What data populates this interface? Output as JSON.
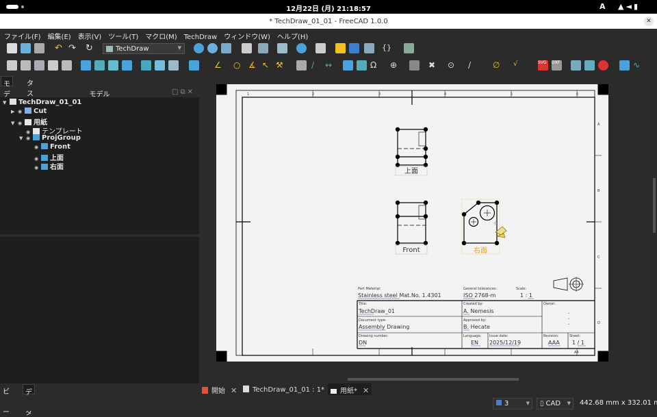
{
  "system": {
    "datetime": "12月22日 (月)  21:18:57",
    "input_indicator": "A"
  },
  "window": {
    "title": "* TechDraw_01_01 - FreeCAD 1.0.0",
    "close_glyph": "✕"
  },
  "menu": [
    "ファイル(F)",
    "編集(E)",
    "表示(V)",
    "ツール(T)",
    "マクロ(M)",
    "TechDraw",
    "ウィンドウ(W)",
    "ヘルプ(H)"
  ],
  "toolbar": {
    "workbench": "TechDraw"
  },
  "left_panel": {
    "tabs": [
      "モデル",
      "タスク"
    ],
    "header": "モデル",
    "tree": [
      {
        "label": "TechDraw_01_01",
        "level": 0,
        "expanded": true,
        "bold": true,
        "icon_color": "#e0e0e0"
      },
      {
        "label": "Cut",
        "level": 1,
        "expanded": false,
        "bold": true,
        "icon_color": "#7ab3e8"
      },
      {
        "label": "用紙",
        "level": 1,
        "expanded": true,
        "bold": true,
        "icon_color": "#e8e8e8"
      },
      {
        "label": "テンプレート",
        "level": 2,
        "expanded": null,
        "bold": false,
        "icon_color": "#e8e8e8"
      },
      {
        "label": "ProjGroup",
        "level": 2,
        "expanded": true,
        "bold": true,
        "icon_color": "#4aa3d8"
      },
      {
        "label": "Front",
        "level": 3,
        "expanded": null,
        "bold": true,
        "icon_color": "#4aa3d8"
      },
      {
        "label": "上面",
        "level": 3,
        "expanded": null,
        "bold": true,
        "icon_color": "#4aa3d8"
      },
      {
        "label": "右面",
        "level": 3,
        "expanded": null,
        "bold": true,
        "icon_color": "#4aa3d8"
      }
    ],
    "bottom_tabs": [
      "ビュー",
      "データ"
    ]
  },
  "drawing": {
    "columns": [
      "1",
      "2",
      "3",
      "4",
      "5",
      "6"
    ],
    "rows": [
      "A",
      "B",
      "C",
      "D"
    ],
    "view_labels": {
      "top": "上面",
      "front": "Front",
      "right": "右面"
    },
    "sheet_size": "A4",
    "title_block": {
      "part_material_label": "Part Material:",
      "part_material": "Stainless steel Mat.No. 1.4301",
      "tolerances_label": "General tolerances:",
      "tolerances": "ISO 2768-m",
      "scale_label": "Scale:",
      "scale": "1 : 1",
      "title_label": "Title:",
      "title": "TechDraw_01",
      "created_label": "Created by:",
      "created": "A. Nemesis",
      "owner_label": "Owner:",
      "owner_lines": [
        "-",
        "-",
        "-"
      ],
      "doctype_label": "Document type:",
      "doctype": "Assembly Drawing",
      "approved_label": "Approved by:",
      "approved": "B. Hecate",
      "drawing_number_label": "Drawing number:",
      "drawing_number": "DN",
      "language_label": "Language:",
      "language": "EN",
      "issue_label": "Issue date:",
      "issue": "2025/12/19",
      "revision_label": "Revision:",
      "revision": "AAA",
      "sheet_label": "Sheet:",
      "sheet": "1 / 1"
    }
  },
  "doc_tabs": [
    {
      "label": "開始",
      "active": false
    },
    {
      "label": "TechDraw_01_01 : 1*",
      "active": false
    },
    {
      "label": "用紙*",
      "active": true
    }
  ],
  "status": {
    "layer_count": "3",
    "nav_style": "CAD",
    "dimensions": "442.68 mm x 332.01 mm"
  },
  "colors": {
    "accent": "#f0a020",
    "selection": "#f0a020",
    "icon_blue": "#4aa3d8"
  }
}
